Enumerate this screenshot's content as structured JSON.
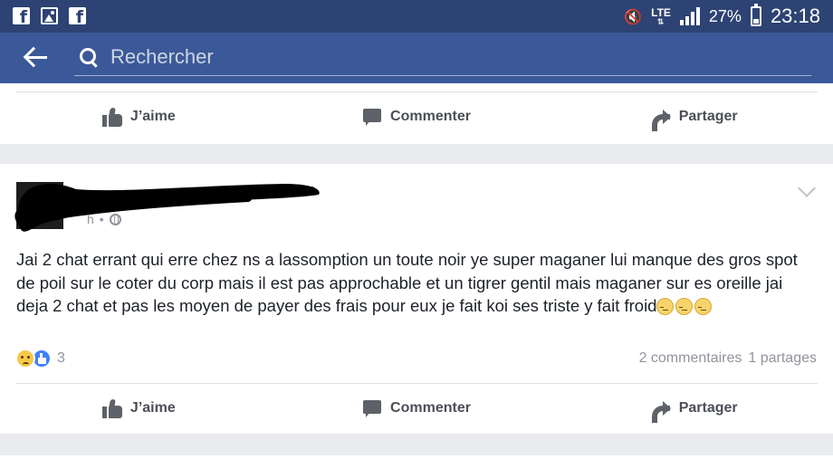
{
  "status_bar": {
    "left_icons": [
      "facebook-icon",
      "gallery-icon",
      "facebook-icon"
    ],
    "network": "LTE",
    "battery_percent": "27%",
    "battery_level": 0.27,
    "time": "23:18"
  },
  "search": {
    "placeholder": "Rechercher"
  },
  "actions": {
    "like": "J’aime",
    "comment": "Commenter",
    "share": "Partager"
  },
  "post": {
    "time_fragment": "h",
    "separator": "•",
    "text": "Jai 2 chat errant qui erre chez ns a lassomption un toute noir ye super maganer lui manque des gros spot de poil sur le coter du corp mais il est pas approchable et un tigrer gentil mais maganer sur es oreille jai deja 2 chat et pas les moyen de payer des frais pour eux je fait koi ses triste y fait froid",
    "emojis": [
      "pensive",
      "pensive",
      "pensive"
    ],
    "reaction_count": "3",
    "comments": "2 commentaires",
    "shares": "1 partages"
  },
  "colors": {
    "status_bar": "#2d4373",
    "search_bar": "#3b5998",
    "feed_background": "#e9ebee",
    "action_text": "#4b4f56",
    "meta_text": "#90949c"
  }
}
